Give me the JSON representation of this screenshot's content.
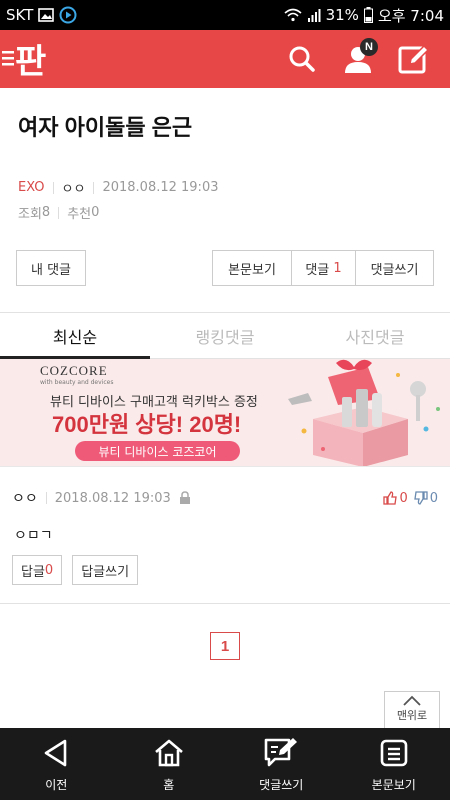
{
  "status_bar": {
    "carrier": "SKT",
    "battery": "31%",
    "time": "오후 7:04"
  },
  "app": {
    "logo_text": "판",
    "notification_badge": "N"
  },
  "article": {
    "title": "여자 아이돌들 은근",
    "category": "EXO",
    "author": "ㅇㅇ",
    "date": "2018.08.12 19:03",
    "views_label": "조회",
    "views": "8",
    "recommend_label": "추천",
    "recommend": "0"
  },
  "actions": {
    "my_comments": "내 댓글",
    "view_post": "본문보기",
    "comments_label": "댓글",
    "comments_count": "1",
    "write_comment": "댓글쓰기"
  },
  "tabs": [
    {
      "label": "최신순",
      "active": true
    },
    {
      "label": "랭킹댓글",
      "active": false
    },
    {
      "label": "사진댓글",
      "active": false
    }
  ],
  "ad": {
    "brand": "COZCORE",
    "brand_sub": "with beauty and devices",
    "line1": "뷰티 디바이스 구매고객 럭키박스 증정",
    "line2": "700만원 상당! 20명!",
    "pill": "뷰티 디바이스 코즈코어"
  },
  "comment": {
    "author": "ㅇㅇ",
    "date": "2018.08.12 19:03",
    "upvotes": "0",
    "downvotes": "0",
    "body": "ㅇㅁㄱ",
    "reply_label": "답글",
    "reply_count": "0",
    "write_reply": "답글쓰기"
  },
  "pager": {
    "current": "1"
  },
  "to_top": {
    "label": "맨위로"
  },
  "bottom_nav": [
    {
      "label": "이전",
      "icon": "back-triangle-icon"
    },
    {
      "label": "홈",
      "icon": "home-icon"
    },
    {
      "label": "댓글쓰기",
      "icon": "comment-write-icon"
    },
    {
      "label": "본문보기",
      "icon": "document-icon"
    }
  ],
  "colors": {
    "brand_red": "#e84748",
    "accent_red": "#d94a4a",
    "bottom_bar": "#1a1a1a"
  }
}
